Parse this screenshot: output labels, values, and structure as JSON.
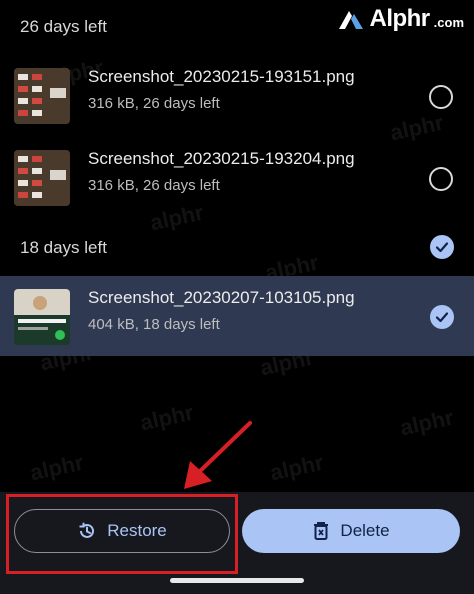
{
  "logo": {
    "word": "Alphr",
    "suffix": ".com"
  },
  "groups": [
    {
      "header": "26 days left",
      "items": [
        {
          "name": "Screenshot_20230215-193151.png",
          "meta": "316 kB, 26 days left",
          "selected": false
        },
        {
          "name": "Screenshot_20230215-193204.png",
          "meta": "316 kB, 26 days left",
          "selected": false
        }
      ]
    },
    {
      "header": "18 days left",
      "header_checked": true,
      "items": [
        {
          "name": "Screenshot_20230207-103105.png",
          "meta": "404 kB, 18 days left",
          "selected": true
        }
      ]
    }
  ],
  "actions": {
    "restore_label": "Restore",
    "delete_label": "Delete"
  },
  "watermark": "alphr",
  "icons": {
    "restore": "history-icon",
    "delete": "trash-icon",
    "checked": "check-circle-icon",
    "unchecked": "radio-circle-icon",
    "annotation_arrow": "red-arrow"
  },
  "colors": {
    "background": "#000000",
    "selected_row": "#2f3a52",
    "accent": "#a9c4f5",
    "annotation": "#d71f26"
  }
}
